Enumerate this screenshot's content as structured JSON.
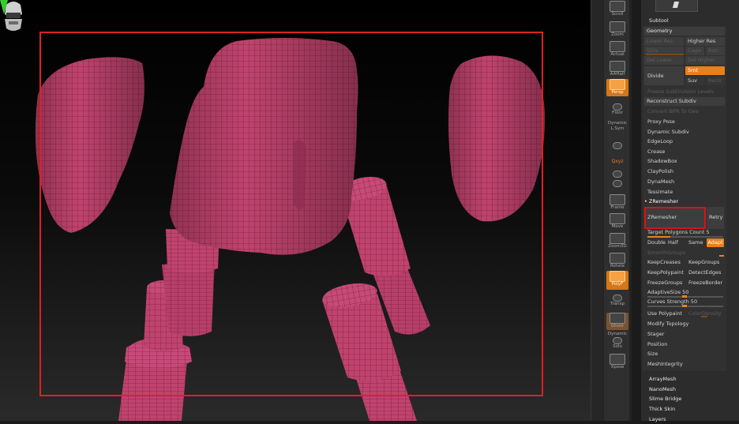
{
  "colors": {
    "mesh": "#c0436e",
    "wire": "#5e1a33",
    "accent": "#e8801a",
    "highlight": "#d41515"
  },
  "viewport": {
    "camera_icon": "camera-head-icon",
    "axis_icon": "y-axis-icon"
  },
  "shelf": {
    "buttons": [
      {
        "label": "Scroll",
        "icon": "scroll-icon"
      },
      {
        "label": "Zoom",
        "icon": "zoom-icon"
      },
      {
        "label": "Actual",
        "icon": "actual-icon"
      },
      {
        "label": "AAHalf",
        "icon": "aahalf-icon"
      },
      {
        "label": "Persp",
        "icon": "persp-icon"
      },
      {
        "label": "Floor",
        "icon": "floor-icon"
      },
      {
        "label": "L.Sym",
        "icon": "lsym-icon"
      },
      {
        "label": "",
        "icon": "lock-icon"
      },
      {
        "label": "Qxyz",
        "icon": "qxyz-icon"
      },
      {
        "label": "",
        "icon": "qx-icon"
      },
      {
        "label": "",
        "icon": "qy-icon"
      },
      {
        "label": "Frame",
        "icon": "frame-icon"
      },
      {
        "label": "Move",
        "icon": "move-icon"
      },
      {
        "label": "Zoom3D",
        "icon": "zoom3d-icon"
      },
      {
        "label": "Rotate",
        "icon": "rotate-icon"
      },
      {
        "label": "PolyF",
        "icon": "polyf-icon"
      },
      {
        "label": "Transp",
        "icon": "transp-icon"
      },
      {
        "label": "Ghost",
        "icon": "ghost-icon"
      },
      {
        "label": "Solo",
        "icon": "solo-icon"
      },
      {
        "label": "Xpose",
        "icon": "xpose-icon"
      }
    ],
    "tiny": {
      "dynamic1": "Dynamic",
      "dynamic2": "Dynamic",
      "persp_top": "Dynamic"
    }
  },
  "palette": {
    "subtool": "Subtool",
    "geometry": "Geometry",
    "lower_res": "Lower Res",
    "higher_res": "Higher Res",
    "sdiv": "SDiv",
    "cage": "Cage",
    "rstr": "Rstr",
    "del_lower": "Del Lower",
    "del_higher": "Del Higher",
    "divide": "Divide",
    "smt": "Smt",
    "suv": "Suv",
    "reuv": "ReUV",
    "freeze_subdiv": "Freeze SubDivision Levels",
    "reconstruct": "Reconstruct Subdiv",
    "convert_bpr": "Convert BPR To Geo",
    "proxy_pose": "Proxy Pose",
    "dynamic_subdiv": "Dynamic Subdiv",
    "edgeloop": "EdgeLoop",
    "crease": "Crease",
    "shadowbox": "ShadowBox",
    "claypolish": "ClayPolish",
    "dynamesh": "DynaMesh",
    "tessimate": "Tessimate",
    "zremesher_hdr": "ZRemesher",
    "zremesher_btn": "ZRemesher",
    "retry": "Retry",
    "target_label": "Target Polygons Count 5",
    "double": "Double",
    "half": "Half",
    "same": "Same",
    "adapt": "Adapt",
    "smoothgroups": "SmoothGroups",
    "keepcreases": "KeepCreases",
    "keepgroups": "KeepGroups",
    "keeppolypaint": "KeepPolypaint",
    "detectedges": "DetectEdges",
    "freezegroups": "FreezeGroups",
    "freezeborder": "FreezeBorder",
    "adaptivesize": "AdaptiveSize 50",
    "curves_strength": "Curves Strength 50",
    "use_polypaint": "Use Polypaint",
    "colordensity": "ColorDensity",
    "modify_topology": "Modify Topology",
    "stager": "Stager",
    "position": "Position",
    "size": "Size",
    "meshintegrity": "MeshIntegrity",
    "arraymesh": "ArrayMesh",
    "nanomesh": "NanoMesh",
    "slime_bridge": "Slime Bridge",
    "thick_skin": "Thick Skin",
    "layers": "Layers"
  },
  "sliders": {
    "target_polygons": 0.3,
    "adaptive_size": 0.5,
    "curves_strength": 0.5
  }
}
